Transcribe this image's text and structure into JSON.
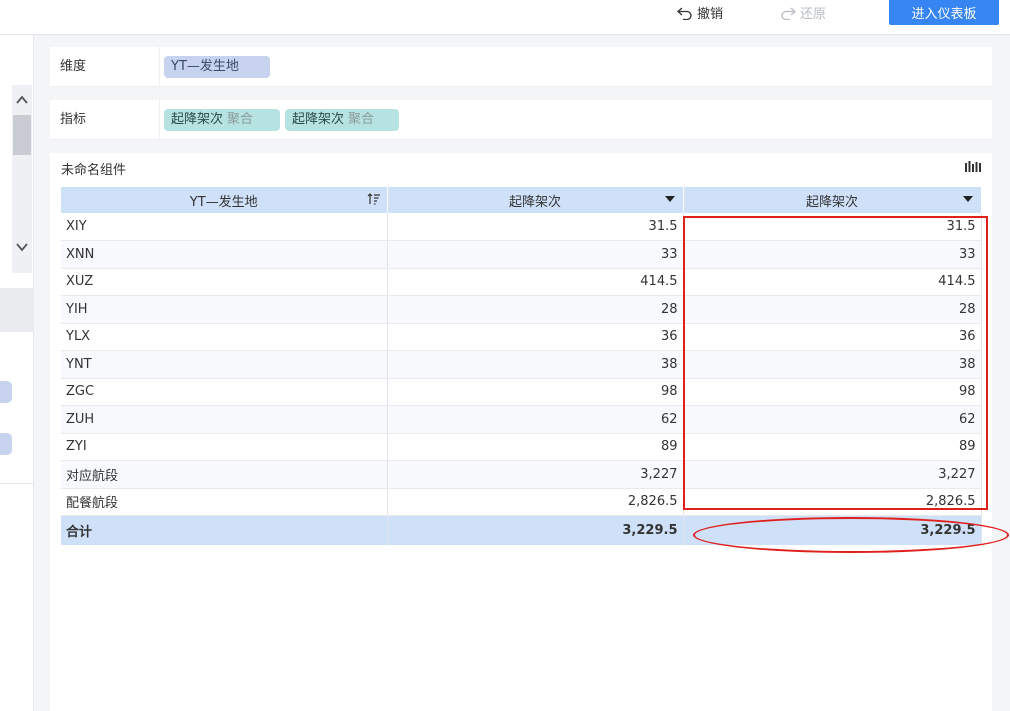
{
  "toolbar": {
    "undo_label": "撤销",
    "redo_label": "还原",
    "enter_dashboard_label": "进入仪表板"
  },
  "dimension_row": {
    "label": "维度",
    "chips": [
      "YT—发生地"
    ]
  },
  "indicator_row": {
    "label": "指标",
    "chips": [
      {
        "name": "起降架次",
        "agg": "聚合"
      },
      {
        "name": "起降架次",
        "agg": "聚合"
      }
    ]
  },
  "component": {
    "title": "未命名组件",
    "columns": [
      "YT—发生地",
      "起降架次",
      "起降架次"
    ],
    "rows": [
      [
        "XIY",
        "31.5",
        "31.5"
      ],
      [
        "XNN",
        "33",
        "33"
      ],
      [
        "XUZ",
        "414.5",
        "414.5"
      ],
      [
        "YIH",
        "28",
        "28"
      ],
      [
        "YLX",
        "36",
        "36"
      ],
      [
        "YNT",
        "38",
        "38"
      ],
      [
        "ZGC",
        "98",
        "98"
      ],
      [
        "ZUH",
        "62",
        "62"
      ],
      [
        "ZYI",
        "89",
        "89"
      ],
      [
        "对应航段",
        "3,227",
        "3,227"
      ],
      [
        "配餐航段",
        "2,826.5",
        "2,826.5"
      ]
    ],
    "total": [
      "合计",
      "3,229.5",
      "3,229.5"
    ]
  },
  "colors": {
    "primary": "#3685f2",
    "header_bg": "#cfe0f9",
    "dim_chip": "#c7d3ee",
    "ind_chip": "#b6e3e1",
    "annotation": "#e0201b"
  }
}
